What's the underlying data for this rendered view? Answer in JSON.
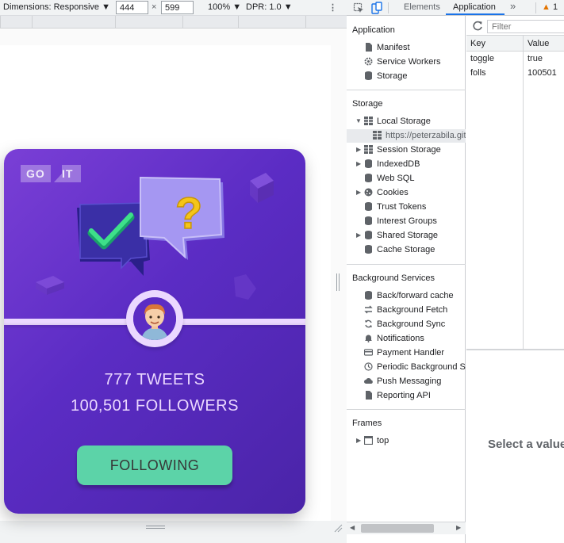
{
  "device_toolbar": {
    "dimensions_label": "Dimensions: Responsive",
    "width_value": "444",
    "times": "×",
    "height_value": "599",
    "zoom": "100%",
    "dpr": "DPR: 1.0",
    "more_icon": "more-vert-icon"
  },
  "card": {
    "logo_left": "GO",
    "logo_right": "IT",
    "tweets": "777 TWEETS",
    "followers": "100,501 FOLLOWERS",
    "button_label": "FOLLOWING",
    "colors": {
      "card_bg": "#5b2cc4",
      "button": "#5cd3a8",
      "text": "#ebd8ff"
    }
  },
  "devtools": {
    "tabs": {
      "elements": "Elements",
      "application": "Application",
      "overflow": "»",
      "warnings": "1"
    },
    "sidebar": {
      "application_header": "Application",
      "application_items": [
        "Manifest",
        "Service Workers",
        "Storage"
      ],
      "storage_header": "Storage",
      "storage_items": {
        "local_storage": "Local Storage",
        "origin": "https://peterzabila.git",
        "session_storage": "Session Storage",
        "indexeddb": "IndexedDB",
        "websql": "Web SQL",
        "cookies": "Cookies",
        "trust_tokens": "Trust Tokens",
        "interest_groups": "Interest Groups",
        "shared_storage": "Shared Storage",
        "cache_storage": "Cache Storage"
      },
      "background_header": "Background Services",
      "background_items": [
        "Back/forward cache",
        "Background Fetch",
        "Background Sync",
        "Notifications",
        "Payment Handler",
        "Periodic Background Sync",
        "Push Messaging",
        "Reporting API"
      ],
      "frames_header": "Frames",
      "frames_item": "top"
    },
    "storage_view": {
      "filter_placeholder": "Filter",
      "columns": [
        "Key",
        "Value"
      ],
      "rows": [
        {
          "key": "toggle",
          "value": "true"
        },
        {
          "key": "folls",
          "value": "100501"
        }
      ],
      "empty_message": "Select a value"
    }
  }
}
